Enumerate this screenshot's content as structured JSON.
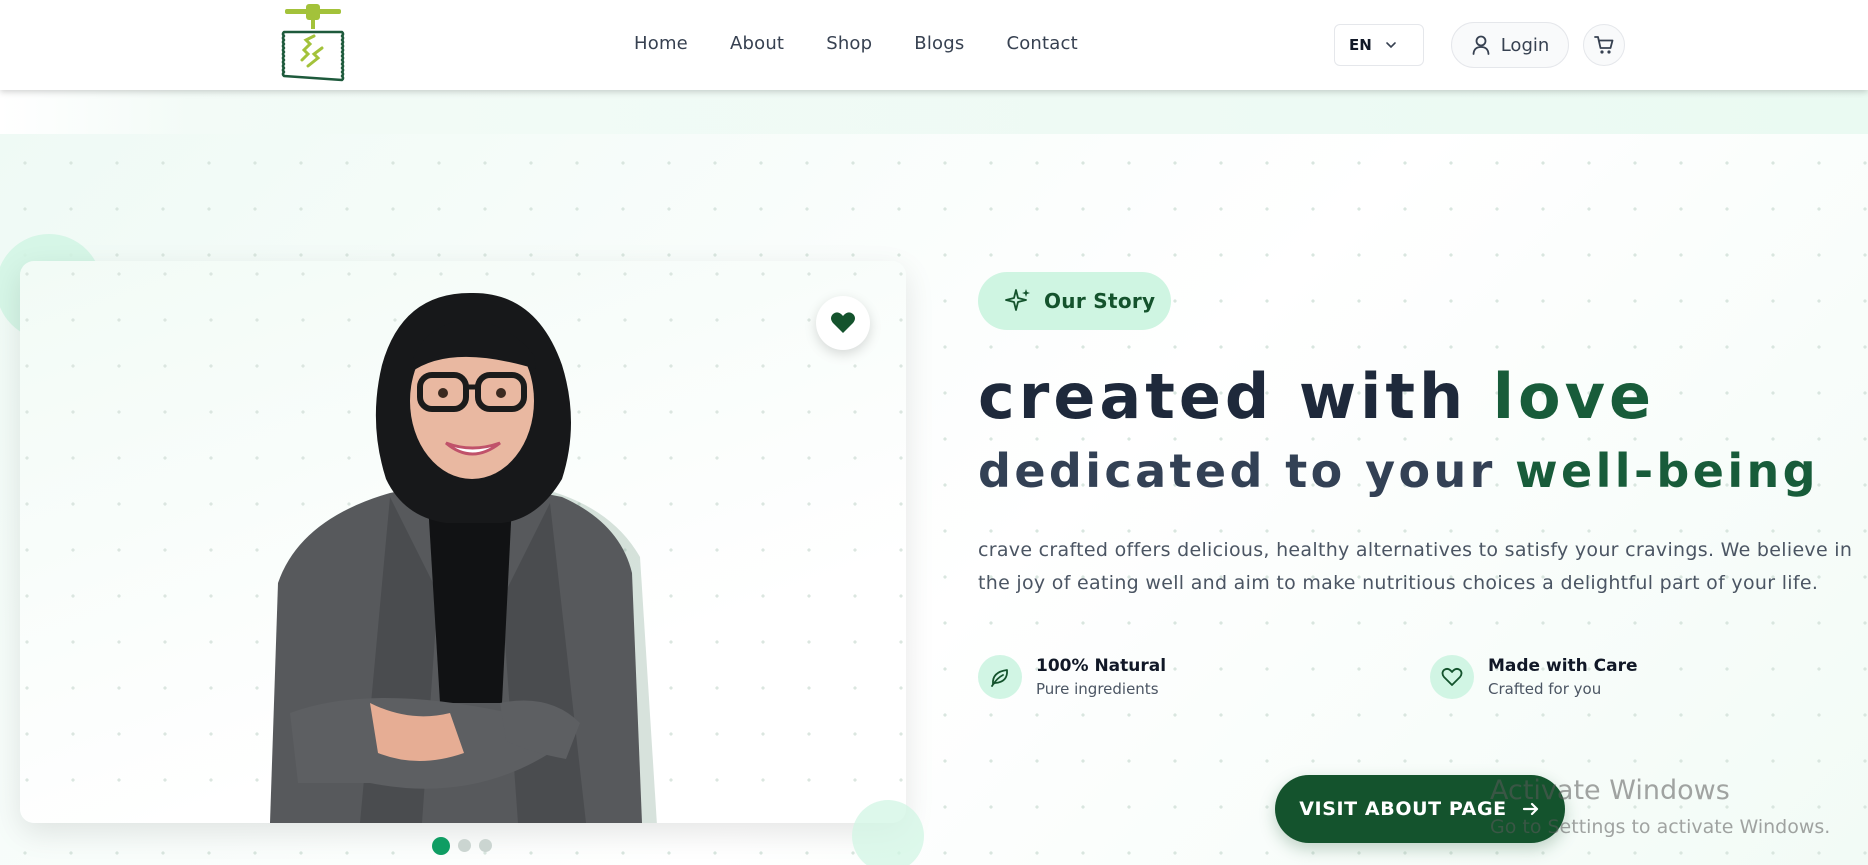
{
  "header": {
    "nav": [
      "Home",
      "About",
      "Shop",
      "Blogs",
      "Contact"
    ],
    "language": "EN",
    "login_label": "Login"
  },
  "hero": {
    "badge": "Our Story",
    "heading_line1": {
      "text": "created with ",
      "accent": "love"
    },
    "heading_line2": {
      "text": "dedicated to your ",
      "accent": "well-being"
    },
    "description": "crave crafted offers delicious, healthy alternatives to satisfy your cravings. We believe in the joy of eating well and aim to make nutritious choices a delightful part of your life.",
    "features": [
      {
        "title": "100% Natural",
        "subtitle": "Pure ingredients",
        "icon": "leaf-icon"
      },
      {
        "title": "Made with Care",
        "subtitle": "Crafted for you",
        "icon": "heart-outline-icon"
      }
    ],
    "cta_label": "VISIT ABOUT PAGE",
    "carousel": {
      "slides": 3,
      "active_index": 0
    }
  },
  "watermark": {
    "title": "Activate Windows",
    "subtitle": "Go to Settings to activate Windows."
  },
  "colors": {
    "brand_dark_green": "#14532d",
    "accent_green": "#185c3a",
    "mint": "#d1f5e4",
    "active_dot": "#0f9d63",
    "logo_lime": "#a3c23a"
  }
}
